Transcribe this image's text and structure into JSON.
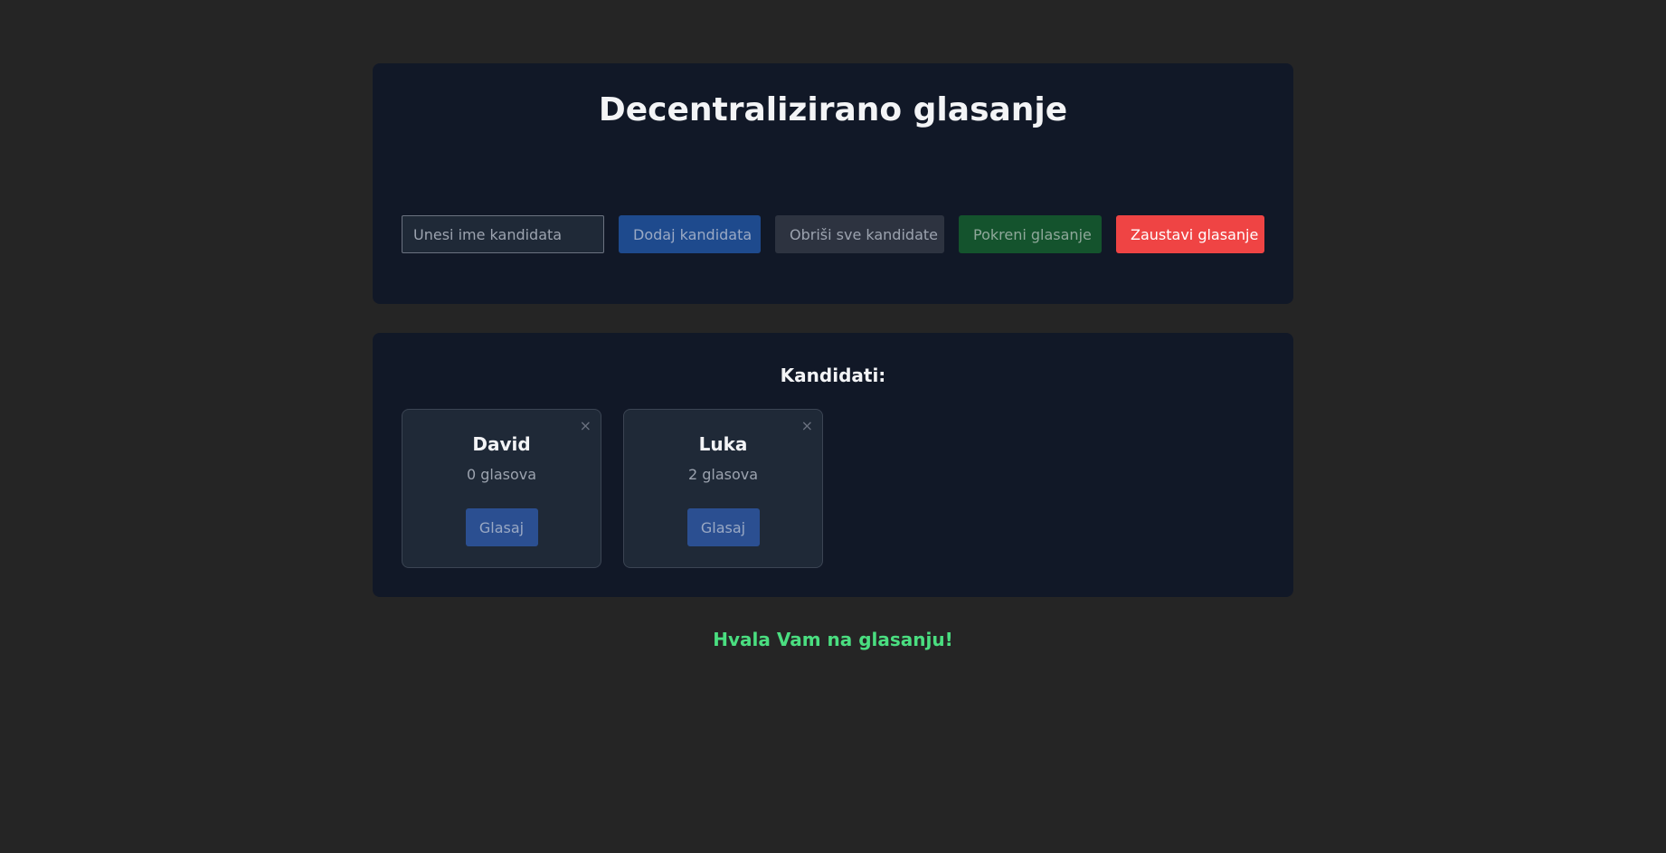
{
  "header": {
    "title": "Decentralizirano glasanje"
  },
  "controls": {
    "input_placeholder": "Unesi ime kandidata",
    "input_value": "",
    "add_label": "Dodaj kandidata",
    "clear_label": "Obriši sve kandidate",
    "start_label": "Pokreni glasanje",
    "stop_label": "Zaustavi glasanje"
  },
  "candidates": {
    "heading": "Kandidati:",
    "close_glyph": "×",
    "items": [
      {
        "name": "David",
        "votes": 0,
        "votes_text": "0 glasova",
        "vote_label": "Glasaj"
      },
      {
        "name": "Luka",
        "votes": 2,
        "votes_text": "2 glasova",
        "vote_label": "Glasaj"
      }
    ]
  },
  "status": {
    "message": "Hvala Vam na glasanju!"
  },
  "colors": {
    "background": "#252525",
    "panel": "#111827",
    "card": "#1f2937",
    "add_button": "#1e4a8d",
    "clear_button": "#2d3340",
    "start_button": "#14532d",
    "stop_button": "#ef4444",
    "vote_button": "#2b4f91",
    "success_text": "#4ade80"
  }
}
